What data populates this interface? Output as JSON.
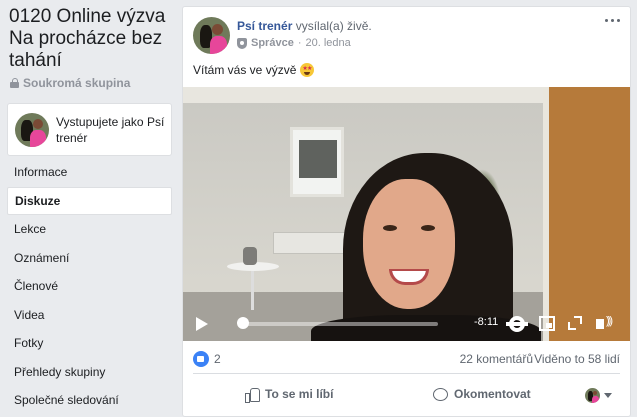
{
  "group": {
    "title": "0120 Online výzva Na procházce bez tahání",
    "privacy": "Soukromá skupina"
  },
  "acting_as": {
    "label": "Vystupujete jako Psí trenér"
  },
  "nav": {
    "items": [
      {
        "label": "Informace",
        "active": false
      },
      {
        "label": "Diskuze",
        "active": true
      },
      {
        "label": "Lekce",
        "active": false
      },
      {
        "label": "Oznámení",
        "active": false
      },
      {
        "label": "Členové",
        "active": false
      },
      {
        "label": "Videa",
        "active": false
      },
      {
        "label": "Fotky",
        "active": false
      },
      {
        "label": "Přehledy skupiny",
        "active": false
      },
      {
        "label": "Společné sledování",
        "active": false
      }
    ]
  },
  "post": {
    "author": "Psí trenér",
    "action": "vysílal(a) živě.",
    "role": "Správce",
    "date": "20. ledna",
    "text": "Vítám vás ve výzvě",
    "emoji": "star-struck-emoji"
  },
  "video": {
    "time_remaining": "-8:11",
    "progress": 0.01
  },
  "stats": {
    "likes": "2",
    "comments": "22 komentářů",
    "views": "Viděno to 58 lidí"
  },
  "actions": {
    "like_label": "To se mi líbí",
    "comment_label": "Okomentovat"
  },
  "colors": {
    "author_link": "#365899",
    "like_blue": "#3b82f6",
    "background": "#e9ebee"
  }
}
